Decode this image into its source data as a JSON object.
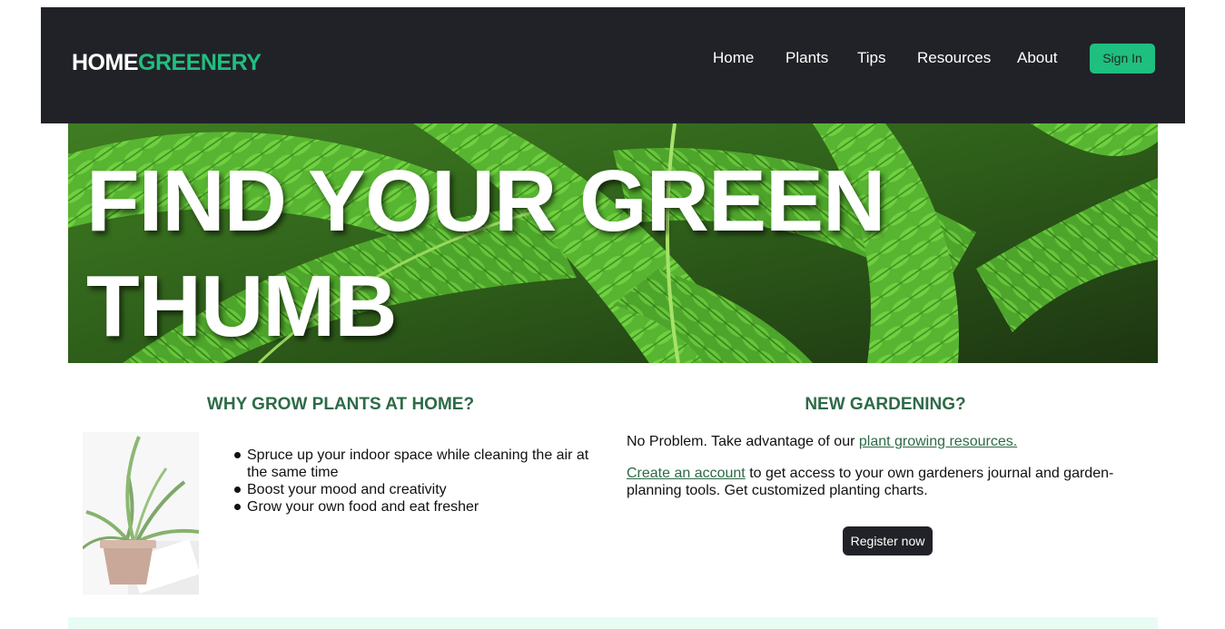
{
  "brand": {
    "part1": "HOME",
    "part2": "GREENERY",
    "color_primary": "#1fbf7f"
  },
  "nav": {
    "links": [
      {
        "label": "Home"
      },
      {
        "label": "Plants"
      },
      {
        "label": "Tips"
      },
      {
        "label": "Resources"
      },
      {
        "label": "About"
      }
    ],
    "signin_label": "Sign In"
  },
  "hero": {
    "title_line1": "FIND YOUR GREEN",
    "title_line2": "THUMB",
    "background_image": "fern-leaves"
  },
  "why": {
    "heading": "WHY GROW PLANTS AT HOME?",
    "image": "aloe-plant-in-pot",
    "benefits": [
      "Spruce up your indoor space while cleaning the air at the same time",
      "Boost your mood and creativity",
      "Grow your own food and eat fresher"
    ]
  },
  "new": {
    "heading": "NEW GARDENING?",
    "p1_text": "No Problem. Take advantage of our ",
    "p1_link": "plant growing resources.",
    "p2_link": "Create an account",
    "p2_text": " to get access to your own gardeners journal and garden-planning tools. Get customized planting charts.",
    "register_label": "Register now"
  },
  "colors": {
    "navbar_bg": "#212227",
    "accent_green": "#1fbf7f",
    "heading_green": "#2d6a47",
    "footer_strip": "#e7fcf3"
  }
}
